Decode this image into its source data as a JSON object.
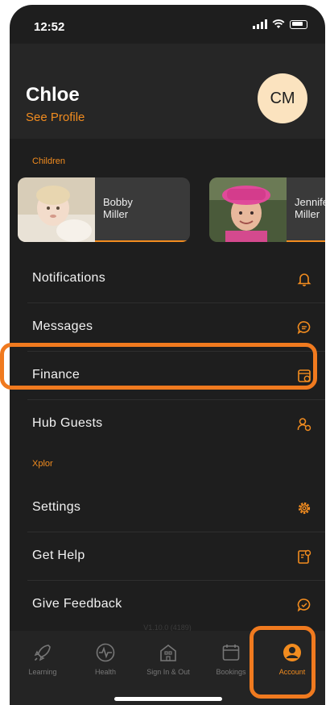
{
  "status_bar": {
    "time": "12:52"
  },
  "profile": {
    "name": "Chloe",
    "see_profile": "See Profile",
    "initials": "CM"
  },
  "children_label": "Children",
  "children": [
    {
      "first_name": "Bobby",
      "last_name": "Miller"
    },
    {
      "first_name": "Jennifer",
      "last_name": "Miller"
    }
  ],
  "menu": {
    "notifications": "Notifications",
    "messages": "Messages",
    "finance": "Finance",
    "hub_guests": "Hub Guests",
    "section_xplor": "Xplor",
    "settings": "Settings",
    "get_help": "Get Help",
    "give_feedback": "Give Feedback"
  },
  "version": "V1.10.0 (4189)",
  "tabs": [
    {
      "label": "Learning",
      "icon": "rocket-icon"
    },
    {
      "label": "Health",
      "icon": "heartbeat-icon"
    },
    {
      "label": "Sign In & Out",
      "icon": "building-icon"
    },
    {
      "label": "Bookings",
      "icon": "calendar-icon"
    },
    {
      "label": "Account",
      "icon": "account-icon"
    }
  ],
  "colors": {
    "accent": "#f28c1f",
    "background": "#1e1e1e",
    "highlight": "#f07a1f"
  }
}
